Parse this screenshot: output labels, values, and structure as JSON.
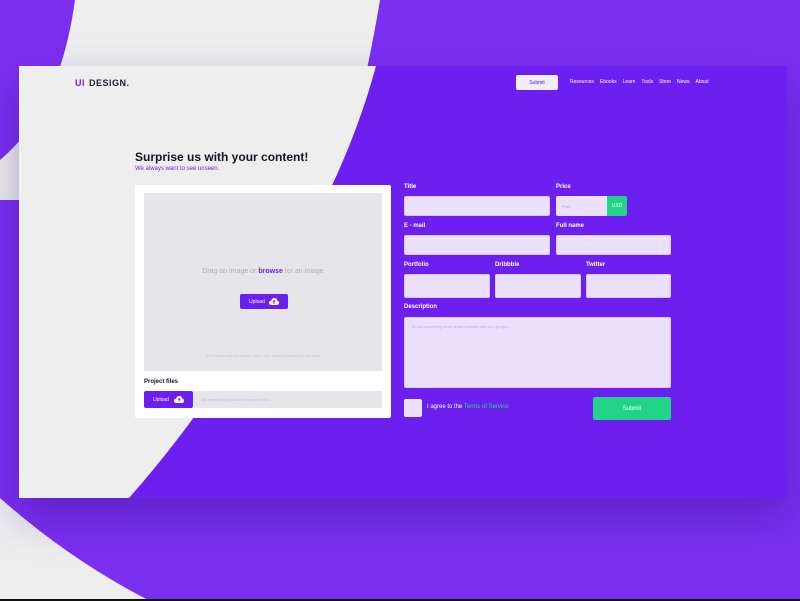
{
  "brand": {
    "prefix": "UI",
    "name": "DESIGN."
  },
  "header": {
    "submit_label": "Submit",
    "nav": [
      "Resources",
      "Ebooks",
      "Learn",
      "Tools",
      "Store",
      "News",
      "About"
    ]
  },
  "main": {
    "title": "Surprise us with your content!",
    "subtitle": "We always want to see unseen."
  },
  "upload": {
    "drag_text_before": "Drag an image or ",
    "drag_text_link": "browse",
    "drag_text_after": " for an image",
    "upload_label": "Upload",
    "hint": "Preview image should be 800 x 600 and not exceed 10 mb limit",
    "project_files_label": "Project files",
    "project_upload_label": "Upload",
    "project_placeholder": "Zip everything you want to send to us ..."
  },
  "form": {
    "title_label": "Title",
    "price_label": "Price",
    "price_placeholder": "Price",
    "currency": "USD",
    "email_label": "E - mail",
    "fullname_label": "Full name",
    "portfolio_label": "Portfolio",
    "dribbble_label": "Dribbble",
    "twitter_label": "Twitter",
    "description_label": "Description",
    "description_placeholder": "Tell us something more about yourself and your project...",
    "agree_text": "I agree to the ",
    "terms_link": "Terms of Service",
    "submit_label": "Submit"
  },
  "colors": {
    "accent": "#6c1fee",
    "green": "#22d38a",
    "light_gray": "#eeeeef",
    "field": "#ebe1ff"
  }
}
